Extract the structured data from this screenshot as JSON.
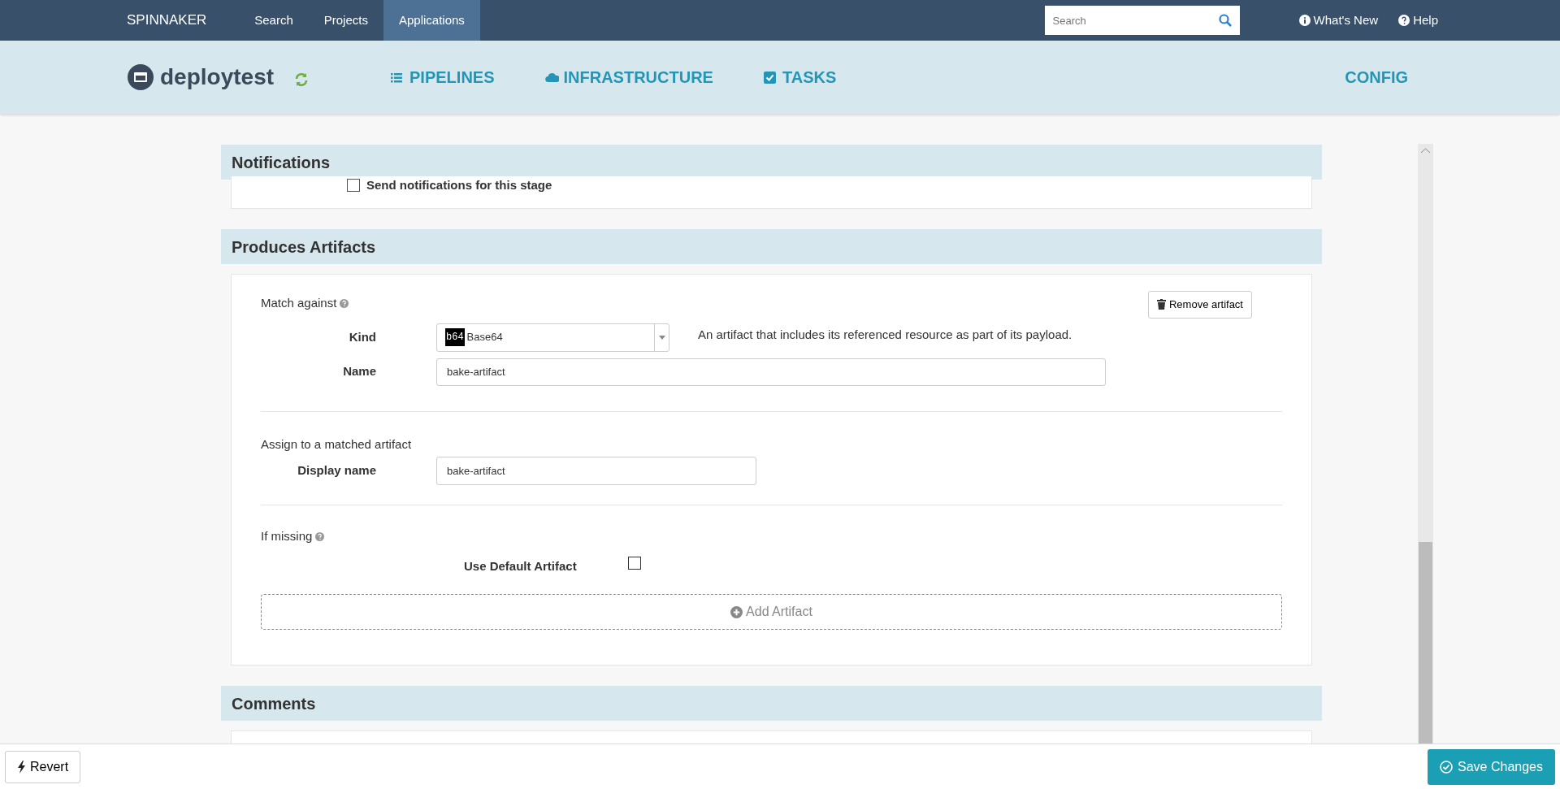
{
  "topbar": {
    "brand": "SPINNAKER",
    "items": [
      {
        "label": "Search",
        "selected": false
      },
      {
        "label": "Projects",
        "selected": false
      },
      {
        "label": "Applications",
        "selected": true
      }
    ],
    "search": {
      "placeholder": "Search"
    },
    "links": [
      {
        "kind": "info",
        "label": "What's New"
      },
      {
        "kind": "help",
        "label": "Help"
      }
    ]
  },
  "app_header": {
    "name": "deploytest",
    "tabs": [
      {
        "kind": "list",
        "label": "PIPELINES"
      },
      {
        "kind": "cloud",
        "label": "INFRASTRUCTURE"
      },
      {
        "kind": "check",
        "label": "TASKS"
      }
    ],
    "config": "CONFIG"
  },
  "notifications": {
    "title": "Notifications",
    "checkbox": {
      "label": "Send notifications for this stage",
      "checked": false
    }
  },
  "produces_artifacts": {
    "title": "Produces Artifacts",
    "match_label": "Match against",
    "remove_button": "Remove artifact",
    "kind": {
      "label": "Kind",
      "badge": "b64",
      "value": "Base64",
      "help": "An artifact that includes its referenced resource as part of its payload."
    },
    "name": {
      "label": "Name",
      "value": "bake-artifact"
    },
    "assign_label": "Assign to a matched artifact",
    "display_name": {
      "label": "Display name",
      "value": "bake-artifact"
    },
    "missing_label": "If missing",
    "use_default": {
      "label": "Use Default Artifact",
      "checked": false
    },
    "add_button": "Add Artifact"
  },
  "comments": {
    "title": "Comments"
  },
  "footer": {
    "revert": "Revert",
    "save": "Save Changes"
  }
}
